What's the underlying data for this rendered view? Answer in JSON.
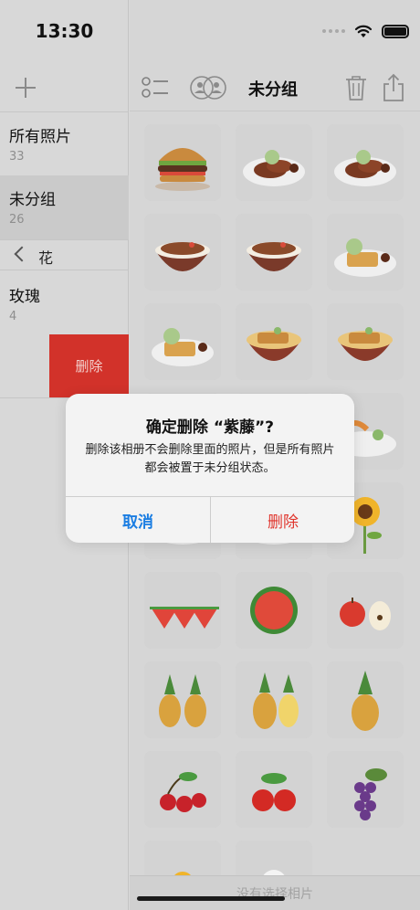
{
  "status_bar": {
    "time": "13:30"
  },
  "sidebar": {
    "add_icon": "plus-icon",
    "albums": [
      {
        "name": "所有照片",
        "count": "33"
      },
      {
        "name": "未分组",
        "count": "26"
      },
      {
        "name": "玫瑰",
        "count": "4"
      }
    ],
    "group": {
      "label": "花",
      "icon": "chevron-left-icon"
    },
    "swipe_delete_label": "删除"
  },
  "toolbar": {
    "title": "未分组",
    "icons": [
      "list-select-icon",
      "face-group-icon",
      "trash-icon",
      "share-icon"
    ]
  },
  "photos": [
    "burger",
    "pork-chops",
    "pork-chops",
    "beef-rice-bowl",
    "beef-rice-bowl",
    "tonkatsu",
    "tonkatsu",
    "katsudon",
    "katsudon",
    "katsu",
    "katsu",
    "shrimp-tempura",
    "dish",
    "dish",
    "sunflower",
    "watermelon-slices",
    "watermelon-half",
    "apple-pear",
    "pineapple-pair",
    "pineapple-cut",
    "pineapple",
    "cherries",
    "tomatoes",
    "grapes",
    "sunflowers",
    "white-flowers"
  ],
  "bottom_bar": {
    "message": "没有选择相片"
  },
  "alert": {
    "title": "确定删除 “紫藤”?",
    "message": "删除该相册不会删除里面的照片，但是所有照片都会被置于未分组状态。",
    "cancel_label": "取消",
    "delete_label": "删除"
  },
  "colors": {
    "accent": "#1a7de2",
    "destructive": "#e0352d",
    "swipe_delete": "#d2322a"
  }
}
